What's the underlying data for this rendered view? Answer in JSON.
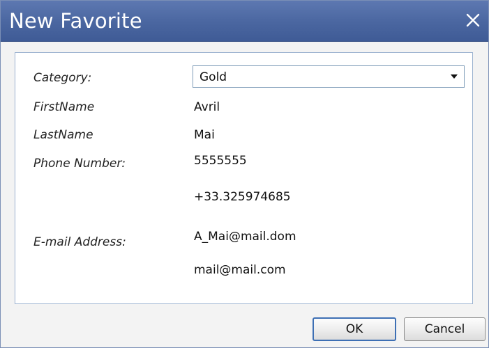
{
  "window": {
    "title": "New Favorite",
    "close_icon": "close-icon"
  },
  "form": {
    "category": {
      "label": "Category:",
      "selected": "Gold"
    },
    "first_name": {
      "label": "FirstName",
      "value": "Avril"
    },
    "last_name": {
      "label": "LastName",
      "value": "Mai"
    },
    "phone": {
      "label": "Phone Number:",
      "values": [
        "5555555",
        "+33.325974685"
      ]
    },
    "email": {
      "label": "E-mail Address:",
      "values": [
        "A_Mai@mail.dom",
        "mail@mail.com"
      ]
    }
  },
  "buttons": {
    "ok": "OK",
    "cancel": "Cancel"
  },
  "colors": {
    "titlebar": "#4a66a0",
    "title_text": "#ffffff",
    "panel_border": "#9bb2d0",
    "ok_focus_border": "#3d6fb4"
  }
}
